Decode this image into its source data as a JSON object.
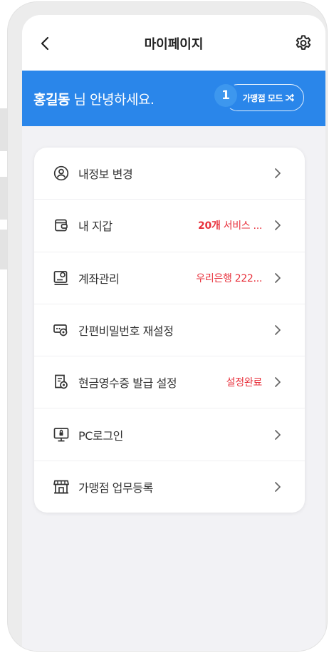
{
  "header": {
    "title": "마이페이지",
    "back_icon": "chevron-left-icon",
    "settings_icon": "gear-icon"
  },
  "banner": {
    "user_name": "홍길동",
    "greeting_suffix": " 님 안녕하세요.",
    "mode_badge": "1",
    "mode_button_label": "가맹점 모드",
    "mode_icon": "shuffle-icon",
    "background_color": "#2a86ea"
  },
  "menu": {
    "items": [
      {
        "label": "내정보 변경",
        "value": "",
        "icon": "user-circle-icon"
      },
      {
        "label": "내 지갑",
        "value": "20개 서비스 ...",
        "icon": "wallet-icon"
      },
      {
        "label": "계좌관리",
        "value": "우리은행 222...",
        "icon": "account-book-icon"
      },
      {
        "label": "간편비밀번호 재설정",
        "value": "",
        "icon": "password-reset-icon"
      },
      {
        "label": "현금영수증 발급 설정",
        "value": "설정완료",
        "icon": "receipt-settings-icon"
      },
      {
        "label": "PC로그인",
        "value": "",
        "icon": "pc-lock-icon"
      },
      {
        "label": "가맹점 업무등록",
        "value": "",
        "icon": "store-icon"
      }
    ],
    "value_color": "#e8313c"
  }
}
